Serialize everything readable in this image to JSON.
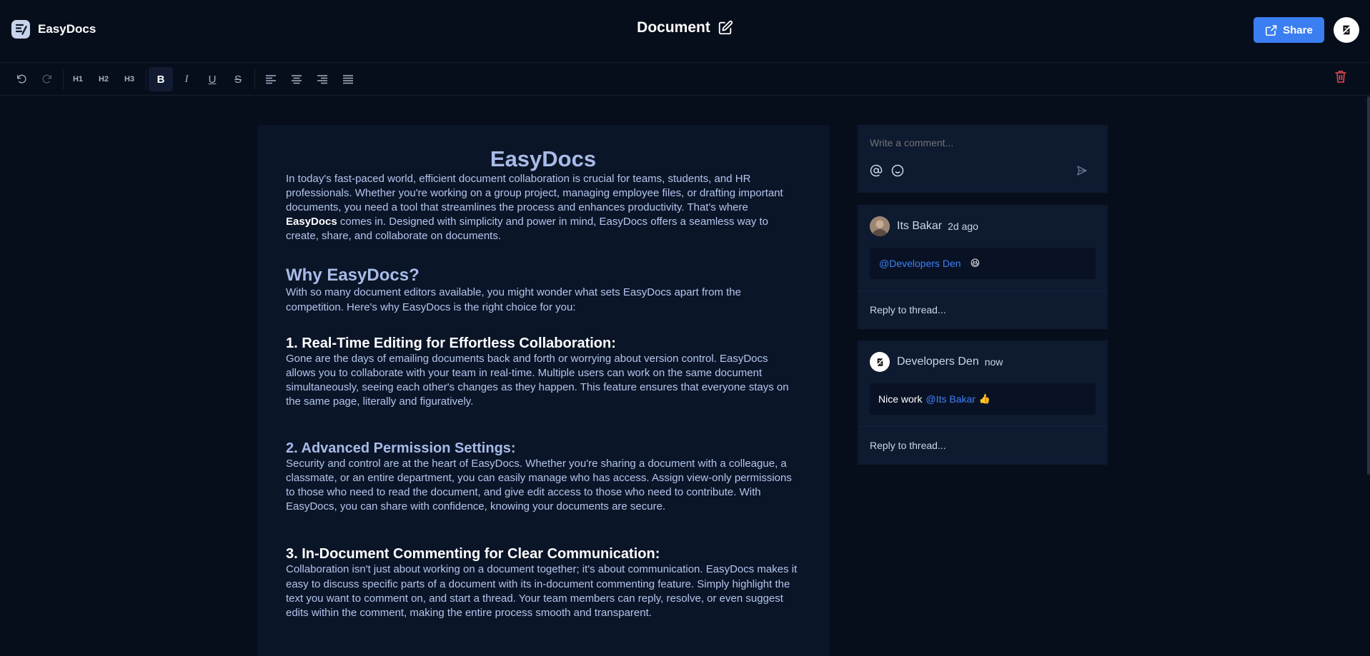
{
  "header": {
    "app_name": "EasyDocs",
    "doc_title": "Document",
    "share_label": "Share"
  },
  "toolbar": {
    "h1": "H1",
    "h2": "H2",
    "h3": "H3",
    "bold": "B",
    "italic": "I",
    "underline": "U",
    "strike": "S"
  },
  "document": {
    "title": "EasyDocs",
    "intro_1": "In today's fast-paced world, efficient document collaboration is crucial for teams, students, and HR professionals. Whether you're working on a group project, managing employee files, or drafting important documents, you need a tool that streamlines the process and enhances productivity. That's where ",
    "intro_bold": "EasyDocs",
    "intro_2": " comes in. Designed with simplicity and power in mind, EasyDocs offers a seamless way to create, share, and collaborate on documents.",
    "why_heading": "Why EasyDocs?",
    "why_text": "With so many document editors available, you might wonder what sets EasyDocs apart from the competition. Here's why EasyDocs is the right choice for you:",
    "s1_heading": "1. Real-Time Editing for Effortless Collaboration:",
    "s1_text": "Gone are the days of emailing documents back and forth or worrying about version control. EasyDocs allows you to collaborate with your team in real-time. Multiple users can work on the same document simultaneously, seeing each other's changes as they happen. This feature ensures that everyone stays on the same page, literally and figuratively.",
    "s2_heading": "2. Advanced Permission Settings:",
    "s2_text": "Security and control are at the heart of EasyDocs. Whether you're sharing a document with a colleague, a classmate, or an entire department, you can easily manage who has access. Assign view-only permissions to those who need to read the document, and give edit access to those who need to contribute. With EasyDocs, you can share with confidence, knowing your documents are secure.",
    "s3_heading": "3. In-Document Commenting for Clear Communication:",
    "s3_text": "Collaboration isn't just about working on a document together; it's about communication. EasyDocs makes it easy to discuss specific parts of a document with its in-document commenting feature. Simply highlight the text you want to comment on, and start a thread. Your team members can reply, resolve, or even suggest edits within the comment, making the entire process smooth and transparent."
  },
  "comment_composer": {
    "placeholder": "Write a comment..."
  },
  "threads": [
    {
      "author": "Its Bakar",
      "time": "2d ago",
      "mention": "@Developers Den",
      "text_before": "",
      "emoji": "😆",
      "reply_placeholder": "Reply to thread..."
    },
    {
      "author": "Developers Den",
      "time": "now",
      "text_before": "Nice work",
      "mention": "@Its Bakar",
      "emoji": "👍",
      "reply_placeholder": "Reply to thread..."
    }
  ],
  "colors": {
    "background": "#070e1b",
    "panel": "#0d1a30",
    "accent": "#3b7ef2",
    "danger": "#e5484d",
    "heading": "#a8bbe8"
  }
}
